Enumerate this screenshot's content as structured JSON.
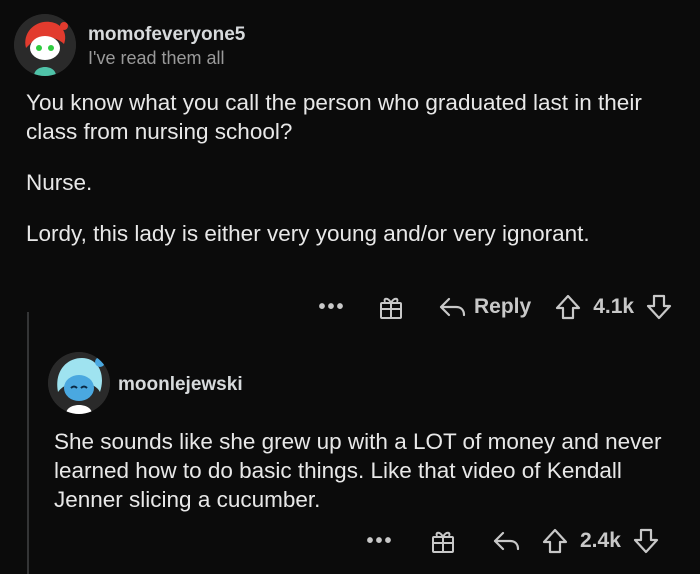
{
  "comments": [
    {
      "username": "momofeveryone5",
      "flair": "I've read them all",
      "paragraphs": [
        "You know what you call the person who graduated last in their class from nursing school?",
        "Nurse.",
        "Lordy, this lady is either very young and/or very ignorant."
      ],
      "more_label": "•••",
      "reply_label": "Reply",
      "vote_count": "4.1k"
    },
    {
      "username": "moonlejewski",
      "paragraphs": [
        "She sounds like she grew up with a LOT of money and never learned how to do basic things. Like that video of Kendall Jenner slicing a cucumber."
      ],
      "more_label": "•••",
      "vote_count": "2.4k"
    }
  ],
  "colors": {
    "background": "#0b0b0b",
    "text": "#e8e8e8",
    "muted": "#9a9a9a",
    "avatar1_accent": "#e23b2e",
    "avatar2_accent": "#4aa8e0"
  },
  "icons": [
    "more-icon",
    "award-icon",
    "reply-icon",
    "upvote-icon",
    "downvote-icon"
  ]
}
